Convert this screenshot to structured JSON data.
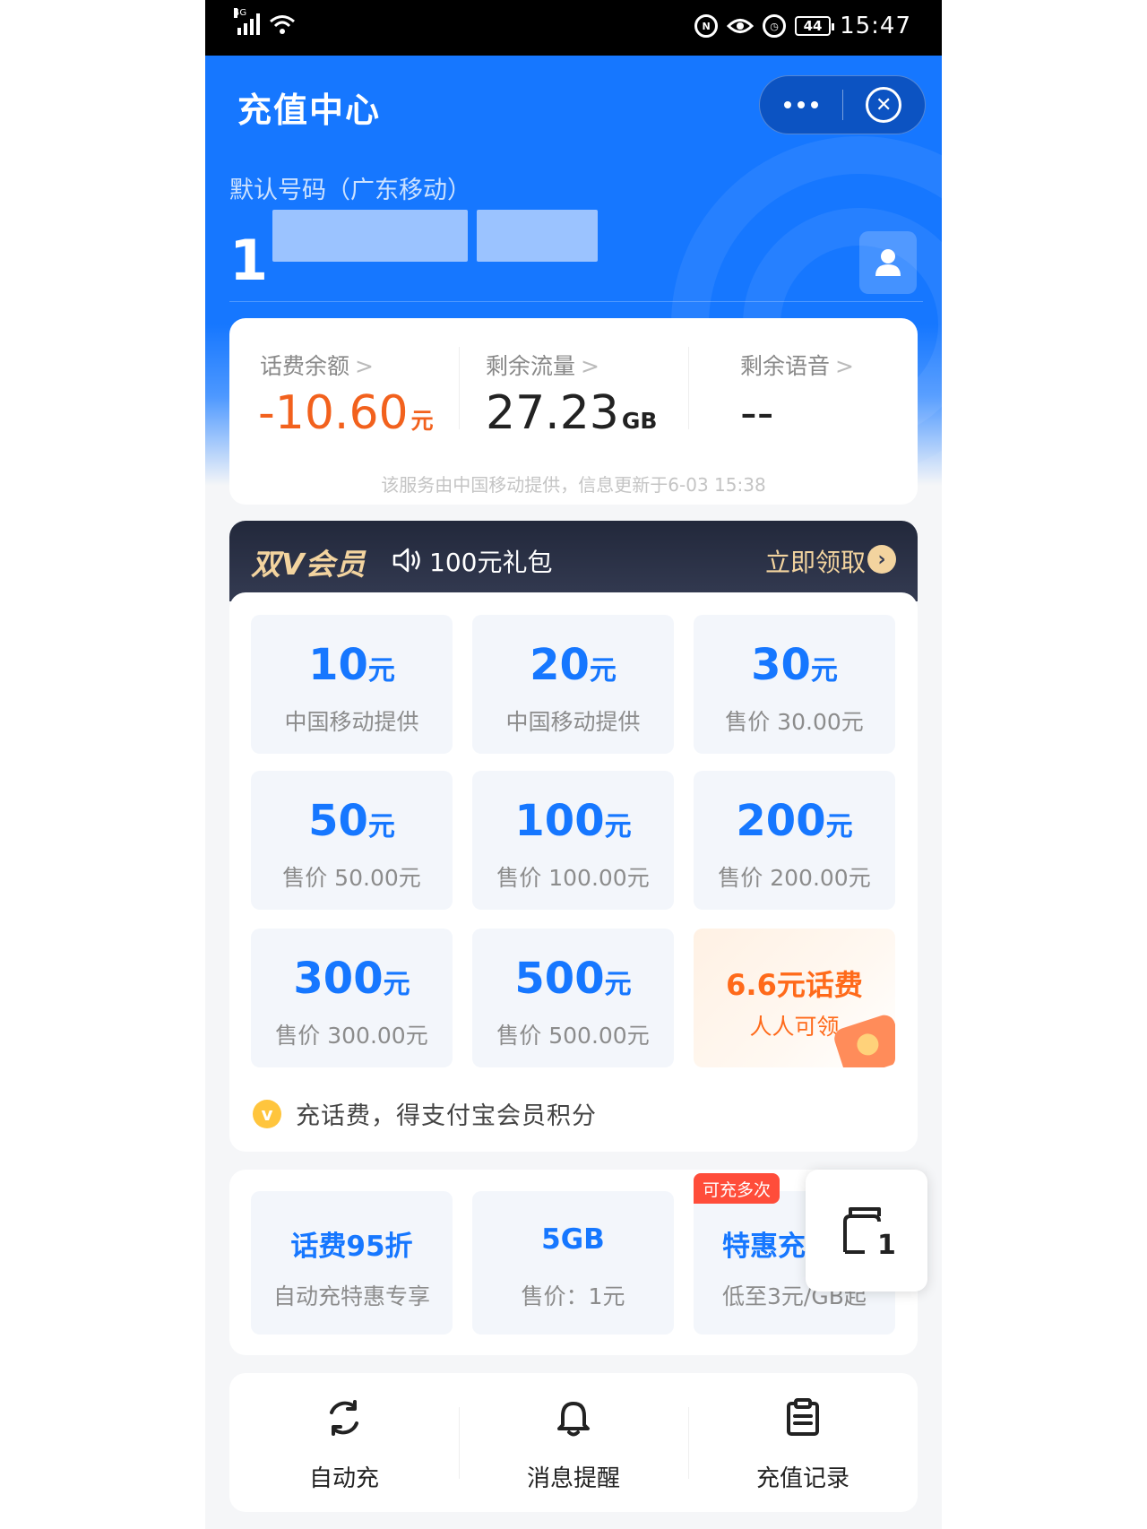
{
  "status_bar": {
    "network": "4G",
    "battery": "44",
    "time": "15:47"
  },
  "header": {
    "title": "充值中心",
    "number_label": "默认号码（广东移动）",
    "phone_prefix": "1"
  },
  "balance": {
    "items": [
      {
        "label": "话费余额",
        "value": "-10.60",
        "unit": "元",
        "color": "#f2611d"
      },
      {
        "label": "剩余流量",
        "value": "27.23",
        "unit": "GB",
        "color": "#222222"
      },
      {
        "label": "剩余语音",
        "value": "--",
        "unit": "",
        "color": "#222222"
      }
    ],
    "note": "该服务由中国移动提供，信息更新于6-03 15:38"
  },
  "vip_banner": {
    "title": "双V会员",
    "gift": "100元礼包",
    "cta": "立即领取"
  },
  "recharge_options": [
    {
      "amount": "10",
      "unit": "元",
      "sub": "中国移动提供"
    },
    {
      "amount": "20",
      "unit": "元",
      "sub": "中国移动提供"
    },
    {
      "amount": "30",
      "unit": "元",
      "sub": "售价 30.00元"
    },
    {
      "amount": "50",
      "unit": "元",
      "sub": "售价 50.00元"
    },
    {
      "amount": "100",
      "unit": "元",
      "sub": "售价 100.00元"
    },
    {
      "amount": "200",
      "unit": "元",
      "sub": "售价 200.00元"
    },
    {
      "amount": "300",
      "unit": "元",
      "sub": "售价 300.00元"
    },
    {
      "amount": "500",
      "unit": "元",
      "sub": "售价 500.00元"
    }
  ],
  "promo_tile": {
    "title": "6.6元话费",
    "sub": "人人可领"
  },
  "points_text": "充话费，得支付宝会员积分",
  "offers": [
    {
      "title": "话费95折",
      "sub": "自动充特惠专享",
      "tag": ""
    },
    {
      "title": "5GB",
      "sub": "售价：1元",
      "tag": ""
    },
    {
      "title": "特惠充",
      "sub": "低至3元/GB起",
      "tag": "可充多次"
    }
  ],
  "float_button": {
    "badge": "1"
  },
  "actions": [
    {
      "label": "自动充",
      "icon": "auto-recharge-icon"
    },
    {
      "label": "消息提醒",
      "icon": "bell-icon"
    },
    {
      "label": "充值记录",
      "icon": "clipboard-icon"
    }
  ],
  "colors": {
    "brand_blue": "#1677ff",
    "negative_orange": "#f2611d",
    "vip_gold": "#f3d49f",
    "promo_orange": "#ff6a1a",
    "tag_red": "#ff4d3a"
  }
}
